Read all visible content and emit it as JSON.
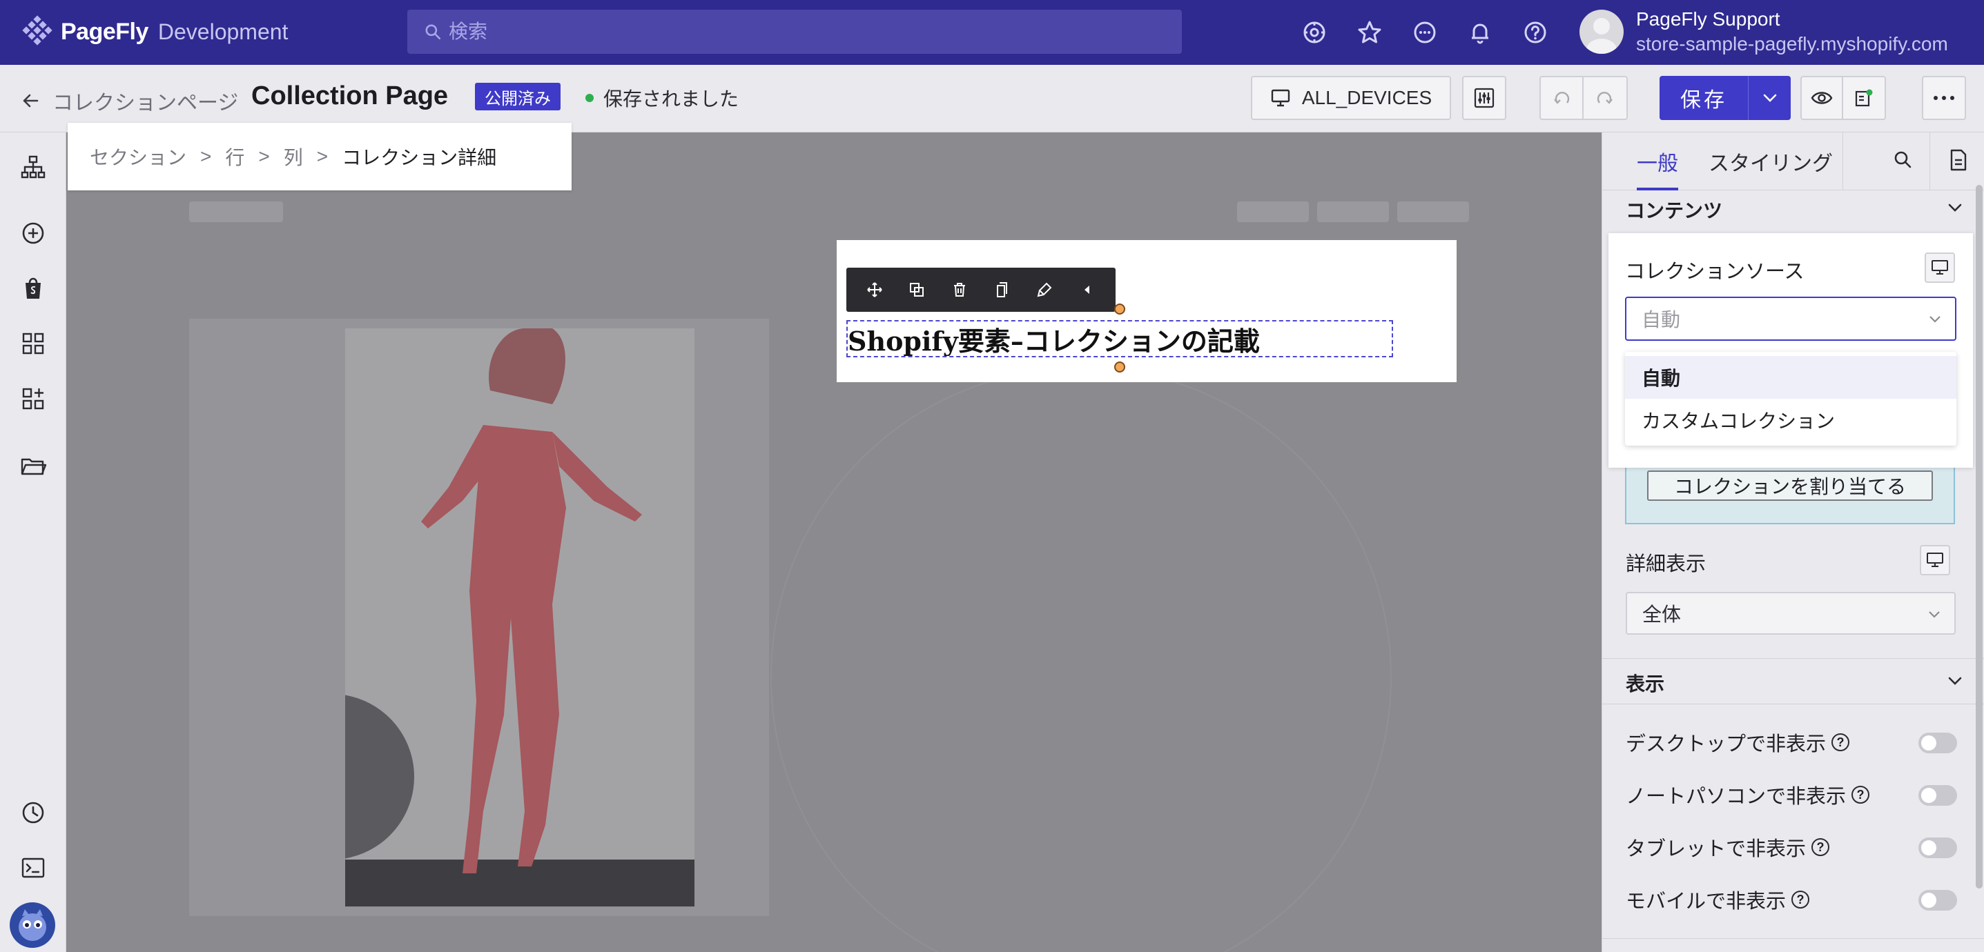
{
  "app": {
    "brand": "PageFly",
    "environment": "Development",
    "search_placeholder": "検索",
    "user_name": "PageFly Support",
    "user_store": "store-sample-pagefly.myshopify.com"
  },
  "subbar": {
    "back_label": "コレクションページ",
    "page_title": "Collection Page",
    "status_badge": "公開済み",
    "saved_status": "保存されました",
    "device_label": "ALL_DEVICES",
    "save_label": "保存"
  },
  "breadcrumb": {
    "items": [
      "セクション",
      "行",
      "列",
      "コレクション詳細"
    ],
    "separator": ">"
  },
  "canvas": {
    "selected_heading": "Shopify要素–コレクションの記載"
  },
  "panel": {
    "tabs": [
      "一般",
      "スタイリング"
    ],
    "content_section": "コンテンツ",
    "collection_source_label": "コレクションソース",
    "collection_source_value": "自動",
    "dropdown_options": [
      "自動",
      "カスタムコレクション"
    ],
    "assign_button": "コレクションを割り当てる",
    "detail_label": "詳細表示",
    "detail_value": "全体",
    "display_section": "表示",
    "toggles": [
      "デスクトップで非表示",
      "ノートパソコンで非表示",
      "タブレットで非表示",
      "モバイルで非表示"
    ],
    "help_glyph": "?"
  },
  "colors": {
    "topbar": "#2f2a8f",
    "accent": "#3f3ac8",
    "saved_dot": "#2fae4f"
  }
}
